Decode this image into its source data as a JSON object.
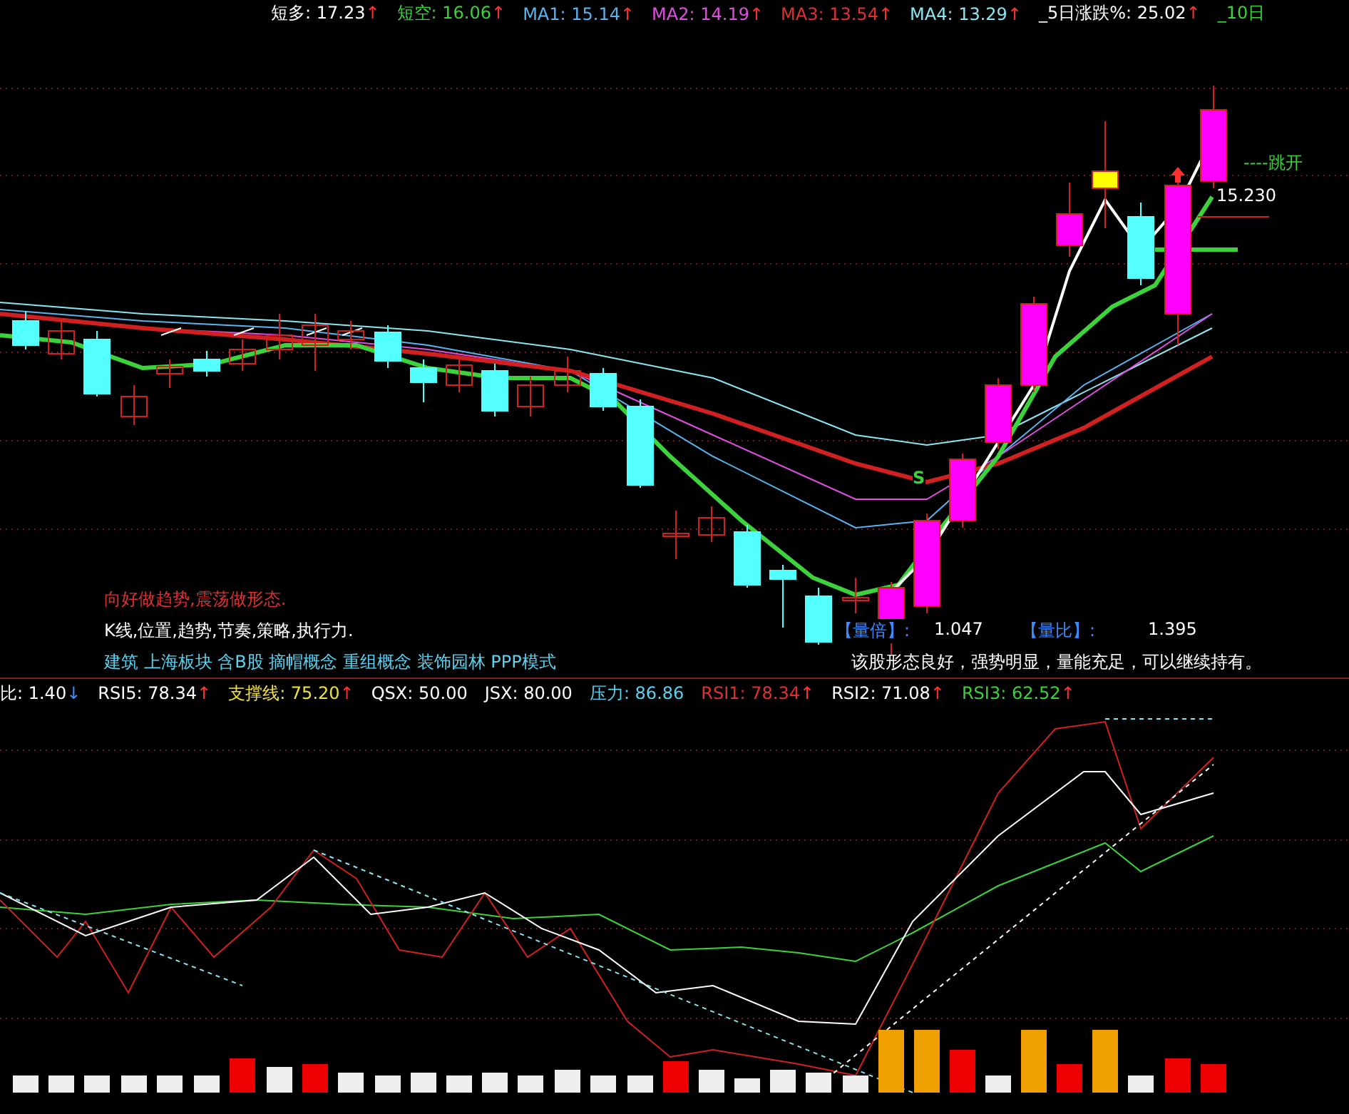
{
  "top_indicators": [
    {
      "label": "短多:",
      "value": "17.23",
      "color": "#ffffff",
      "arrow": "↑",
      "falling": false
    },
    {
      "label": "短空:",
      "value": "16.06",
      "color": "#3cd23c",
      "arrow": "↑",
      "falling": false
    },
    {
      "label": "MA1:",
      "value": "15.14",
      "color": "#5ab4f0",
      "arrow": "↑",
      "falling": false
    },
    {
      "label": "MA2:",
      "value": "14.19",
      "color": "#e050e0",
      "arrow": "↑",
      "falling": false
    },
    {
      "label": "MA3:",
      "value": "13.54",
      "color": "#e03030",
      "arrow": "↑",
      "falling": false
    },
    {
      "label": "MA4:",
      "value": "13.29",
      "color": "#8ae6f0",
      "arrow": "↑",
      "falling": false
    },
    {
      "label": "_5日涨跌%:",
      "value": "25.02",
      "color": "#ffffff",
      "arrow": "↑",
      "falling": false
    },
    {
      "label": "_10日",
      "color": "#3cd23c"
    }
  ],
  "main_chart": {
    "signal_mark": "S",
    "price_label": "15.230",
    "gap_label": "----跳开",
    "notes": [
      {
        "text": "向好做趋势,震荡做形态.",
        "color": "#e03030"
      },
      {
        "text": "K线,位置,趋势,节奏,策略,执行力.",
        "color": "#ffffff"
      },
      {
        "text": "建筑 上海板块 含B股 摘帽概念 重组概念 装饰园林 PPP模式",
        "color": "#5ad2f0"
      }
    ],
    "ratios": [
      {
        "label": "【量倍】:",
        "value": "1.047"
      },
      {
        "label": "【量比】:",
        "value": "1.395"
      }
    ],
    "comment": "该股形态良好，强势明显，量能充足，可以继续持有。"
  },
  "lower_indicators": [
    {
      "label": "比:",
      "value": "1.40",
      "color": "#ffffff",
      "arrow": "↓",
      "falling": true
    },
    {
      "label": "RSI5:",
      "value": "78.34",
      "color": "#ffffff",
      "arrow": "↑",
      "falling": false
    },
    {
      "label": "支撑线:",
      "value": "75.20",
      "color": "#f0e040",
      "arrow": "↑",
      "falling": false
    },
    {
      "label": "QSX:",
      "value": "50.00",
      "color": "#ffffff"
    },
    {
      "label": "JSX:",
      "value": "80.00",
      "color": "#ffffff"
    },
    {
      "label": "压力:",
      "value": "86.86",
      "color": "#5ad2f0"
    },
    {
      "label": "RSI1:",
      "value": "78.34",
      "color": "#e03030",
      "arrow": "↑",
      "falling": false
    },
    {
      "label": "RSI2:",
      "value": "71.08",
      "color": "#ffffff",
      "arrow": "↑",
      "falling": false
    },
    {
      "label": "RSI3:",
      "value": "62.52",
      "color": "#3cd23c",
      "arrow": "↑",
      "falling": false
    }
  ]
}
